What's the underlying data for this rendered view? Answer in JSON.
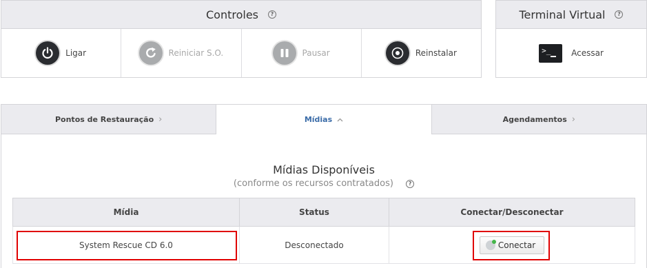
{
  "controls": {
    "title": "Controles",
    "help": "?",
    "items": [
      {
        "label": "Ligar",
        "icon": "power-icon",
        "enabled": true
      },
      {
        "label": "Reiniciar S.O.",
        "icon": "restart-icon",
        "enabled": false
      },
      {
        "label": "Pausar",
        "icon": "pause-icon",
        "enabled": false
      },
      {
        "label": "Reinstalar",
        "icon": "disc-icon",
        "enabled": true
      }
    ]
  },
  "terminal": {
    "title": "Terminal Virtual",
    "help": "?",
    "action_label": "Acessar",
    "icon_text": ">_"
  },
  "tabs": [
    {
      "label": "Pontos de Restauração",
      "active": false,
      "chevron": "›"
    },
    {
      "label": "Mídias",
      "active": true,
      "chevron": "^"
    },
    {
      "label": "Agendamentos",
      "active": false,
      "chevron": "›"
    }
  ],
  "media_section": {
    "title": "Mídias Disponíveis",
    "subtitle": "(conforme os recursos contratados)",
    "help": "?",
    "columns": [
      "Mídia",
      "Status",
      "Conectar/Desconectar"
    ],
    "rows": [
      {
        "media": "System Rescue CD 6.0",
        "status": "Desconectado",
        "action": "Conectar"
      }
    ]
  },
  "colors": {
    "header_bg": "#ebebef",
    "active_tab": "#3b6ca8",
    "highlight": "#e00000",
    "dark_icon": "#2a2c30",
    "disabled_icon": "#a9abad"
  }
}
